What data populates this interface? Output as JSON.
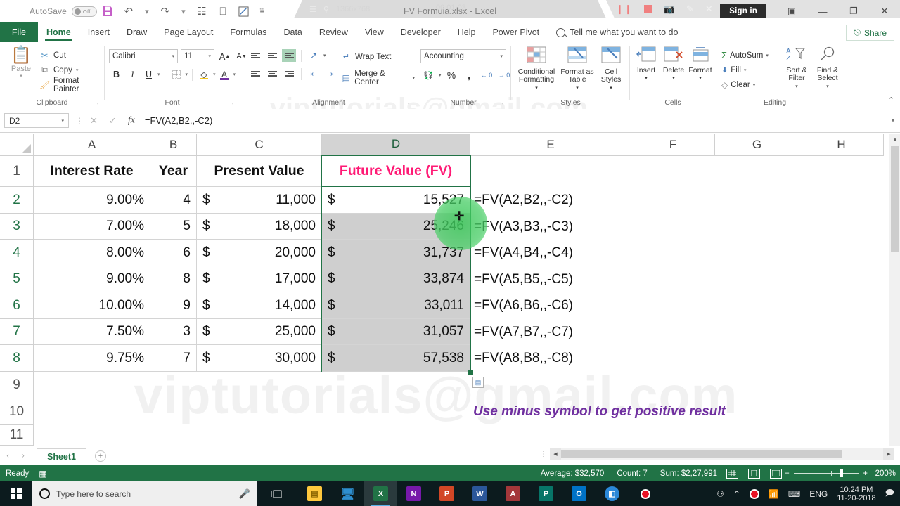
{
  "window": {
    "title": "FV Formula.xlsx  -  Excel",
    "autosave_label": "AutoSave",
    "autosave_state": "Off",
    "signin": "Sign in",
    "minimize": "—",
    "restore": "❐",
    "close": "✕",
    "ribbon_display": "▣"
  },
  "recorder": {
    "resolution": "1366x768",
    "timer": "00:01:03",
    "menu_icon": "hamburger-icon",
    "pin_icon": "pin-icon",
    "pause": "❙❙",
    "camera": "■",
    "pencil": "✎",
    "close": "✕"
  },
  "qat": {
    "save": "save-icon",
    "undo": "↶",
    "redo": "↷",
    "touch": "☷",
    "present": "⎕",
    "custom": "☰",
    "more": "☰"
  },
  "tabs": {
    "file": "File",
    "items": [
      "Home",
      "Insert",
      "Draw",
      "Page Layout",
      "Formulas",
      "Data",
      "Review",
      "View",
      "Developer",
      "Help",
      "Power Pivot"
    ],
    "active": "Home",
    "tellme": "Tell me what you want to do",
    "share": "Share"
  },
  "ribbon": {
    "clipboard": {
      "name": "Clipboard",
      "paste": "Paste",
      "cut": "Cut",
      "copy": "Copy",
      "format_painter": "Format Painter"
    },
    "font": {
      "name": "Font",
      "font_family": "Calibri",
      "font_size": "11",
      "grow": "A",
      "shrink": "A",
      "bold": "B",
      "italic": "I",
      "underline": "U",
      "borders": "⊞",
      "fill_color": "⬛",
      "font_color": "A"
    },
    "alignment": {
      "name": "Alignment",
      "wrap_text": "Wrap Text",
      "merge_center": "Merge & Center"
    },
    "number": {
      "name": "Number",
      "format": "Accounting",
      "percent": "%",
      "comma": "'",
      "increase_decimal": ".00",
      "decrease_decimal": ".00"
    },
    "styles": {
      "name": "Styles",
      "conditional": "Conditional Formatting",
      "format_table": "Format as Table",
      "cell_styles": "Cell Styles"
    },
    "cells": {
      "name": "Cells",
      "insert": "Insert",
      "delete": "Delete",
      "format": "Format"
    },
    "editing": {
      "name": "Editing",
      "autosum": "AutoSum",
      "fill": "Fill",
      "clear": "Clear",
      "sort_filter": "Sort & Filter",
      "find_select": "Find & Select"
    }
  },
  "formula_bar": {
    "name_box": "D2",
    "cancel": "✕",
    "enter": "✓",
    "fx": "fx",
    "formula": "=FV(A2,B2,,-C2)"
  },
  "grid": {
    "columns": [
      "A",
      "B",
      "C",
      "D",
      "E",
      "F",
      "G",
      "H"
    ],
    "selected_column": "D",
    "rows": [
      "1",
      "2",
      "3",
      "4",
      "5",
      "6",
      "7",
      "8",
      "9",
      "10",
      "11"
    ],
    "headers": {
      "a": "Interest Rate",
      "b": "Year",
      "c": "Present Value",
      "d": "Future Value (FV)"
    },
    "currency_symbol": "$",
    "data": [
      {
        "row": "2",
        "rate": "9.00%",
        "year": "4",
        "pv": "11,000",
        "fv": "15,527",
        "formula": "=FV(A2,B2,,-C2)"
      },
      {
        "row": "3",
        "rate": "7.00%",
        "year": "5",
        "pv": "18,000",
        "fv": "25,246",
        "formula": "=FV(A3,B3,,-C3)"
      },
      {
        "row": "4",
        "rate": "8.00%",
        "year": "6",
        "pv": "20,000",
        "fv": "31,737",
        "formula": "=FV(A4,B4,,-C4)"
      },
      {
        "row": "5",
        "rate": "9.00%",
        "year": "8",
        "pv": "17,000",
        "fv": "33,874",
        "formula": "=FV(A5,B5,,-C5)"
      },
      {
        "row": "6",
        "rate": "10.00%",
        "year": "9",
        "pv": "14,000",
        "fv": "33,011",
        "formula": "=FV(A6,B6,,-C6)"
      },
      {
        "row": "7",
        "rate": "7.50%",
        "year": "3",
        "pv": "25,000",
        "fv": "31,057",
        "formula": "=FV(A7,B7,,-C7)"
      },
      {
        "row": "8",
        "rate": "9.75%",
        "year": "7",
        "pv": "30,000",
        "fv": "57,538",
        "formula": "=FV(A8,B8,,-C8)"
      }
    ],
    "note": "Use minus symbol to get positive result",
    "watermark": "viptutorials@gmail.com",
    "quick_analysis": "▤"
  },
  "colors": {
    "accent_green": "#217346",
    "header_pink": "#ff1a75",
    "note_purple": "#7030a0"
  },
  "sheet_tabs": {
    "prev": "‹",
    "next": "›",
    "sheets": [
      "Sheet1"
    ],
    "active": "Sheet1",
    "add": "+"
  },
  "status_bar": {
    "ready": "Ready",
    "average": "Average: $32,570",
    "count": "Count: 7",
    "sum": "Sum: $2,27,991",
    "zoom": "200%",
    "zoom_out": "−",
    "zoom_in": "+"
  },
  "taskbar": {
    "search_placeholder": "Type here to search",
    "language": "ENG",
    "time": "10:24 PM",
    "date": "11-20-2018",
    "apps": [
      {
        "name": "file-explorer",
        "glyph": "▰",
        "color": "#ffc83d"
      },
      {
        "name": "teamviewer",
        "glyph": "◢",
        "color": "#1a6ea8"
      },
      {
        "name": "excel",
        "glyph": "X",
        "color": "#217346"
      },
      {
        "name": "onenote",
        "glyph": "N",
        "color": "#7719aa"
      },
      {
        "name": "powerpoint",
        "glyph": "P",
        "color": "#d24726"
      },
      {
        "name": "word",
        "glyph": "W",
        "color": "#2b579a"
      },
      {
        "name": "access",
        "glyph": "A",
        "color": "#a4373a"
      },
      {
        "name": "publisher",
        "glyph": "P",
        "color": "#077568"
      },
      {
        "name": "outlook",
        "glyph": "O",
        "color": "#0072c6"
      },
      {
        "name": "save-app",
        "glyph": "■",
        "color": "#2b88d8"
      },
      {
        "name": "screen-recorder",
        "glyph": "●",
        "color": "#1a1a1a"
      }
    ]
  }
}
